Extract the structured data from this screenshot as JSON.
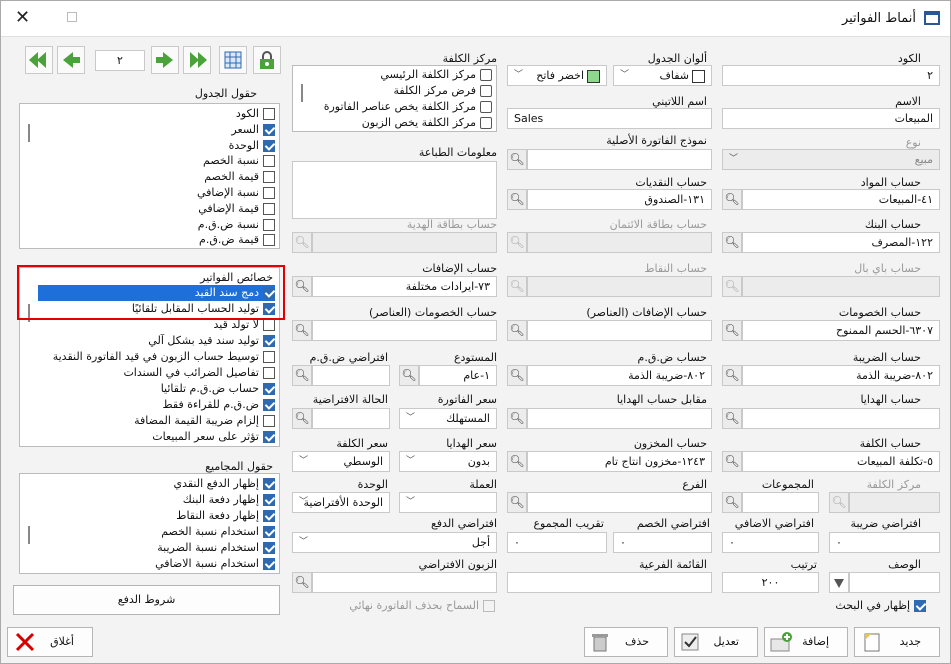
{
  "window": {
    "title": "أنماط الفواتير"
  },
  "toolbar": {
    "page_value": "٢"
  },
  "fields": {
    "code_label": "الكود",
    "code_value": "٢",
    "table_colors_label": "ألوان الجدول",
    "color1": "شفاف",
    "color2": "اخضر فاتح",
    "cost_center_label": "مركز الكلفة",
    "name_label": "الاسم",
    "name_value": "المبيعات",
    "latin_name_label": "اسم اللاتيني",
    "latin_name_value": "Sales",
    "type_label": "نوع",
    "type_value": "مبيع",
    "original_invoice_label": "نموذج الفاتورة الأصلية",
    "print_info_label": "معلومات الطباعة",
    "materials_account_label": "حساب المواد",
    "materials_account_value": "٤١-المبيعات",
    "cash_account_label": "حساب النقديات",
    "cash_account_value": "١٣١-الصندوق",
    "bank_account_label": "حساب البنك",
    "bank_account_value": "١٢٢-المصرف",
    "credit_account_label": "حساب بطاقة الائتمان",
    "gift_card_account_label": "حساب بطاقة الهدية",
    "paypal_account_label": "حساب باي بال",
    "points_account_label": "حساب النقاط",
    "additions_account_label": "حساب الإضافات",
    "additions_account_value": "٧٣-ايرادات مختلفة",
    "discounts_account_label": "حساب الخصومات",
    "discounts_account_value": "٦٣٠٧-الحسم الممنوح",
    "additions_items_label": "حساب الإضافات (العناصر)",
    "discounts_items_label": "حساب الخصومات (العناصر)",
    "tax_account_label": "حساب الضريبة",
    "tax_account_value": "٨٠٢-ضريبة الذمة",
    "vat_account_label": "حساب ض.ق.م",
    "vat_account_value": "٨٠٢-ضريبة الذمة",
    "warehouse_label": "المستودع",
    "warehouse_value": "١-عام",
    "default_vat_label": "افتراضي ض.ق.م",
    "gifts_account_label": "حساب الهدايا",
    "gifts_contra_label": "مقابل حساب الهدايا",
    "invoice_price_label": "سعر الفاتورة",
    "invoice_price_value": "المستهلك",
    "default_state_label": "الحالة الافتراضية",
    "cost_account_label": "حساب الكلفة",
    "cost_account_value": "٥-تكلفة المبيعات",
    "inventory_account_label": "حساب المخزون",
    "inventory_account_value": "١٢٤٣-مخزون انتاج تام",
    "gifts_price_label": "سعر الهدايا",
    "gifts_price_value": "بدون",
    "cost_price_label": "سعر الكلفة",
    "cost_price_value": "الوسطي",
    "cost_center2_label": "مركز الكلفة",
    "groups_label": "المجموعات",
    "branch_label": "الفرع",
    "currency_label": "العملة",
    "unit_label": "الوحدة",
    "unit_value": "الوحدة الأفتراضية",
    "default_tax_label": "افتراضي ضريبة",
    "default_tax_value": "٠",
    "default_addition_label": "افتراضي الاضافي",
    "default_addition_value": "٠",
    "default_discount_label": "افتراضي الخصم",
    "default_discount_value": "٠",
    "total_rounding_label": "تقريب المجموع",
    "total_rounding_value": "٠",
    "default_payment_label": "افتراضي الدفع",
    "default_payment_value": "أجل",
    "description_label": "الوصف",
    "order_label": "ترتيب",
    "order_value": "٢٠٠",
    "sub_list_label": "القائمة الفرعية",
    "default_customer_label": "الزبون الافتراضي",
    "show_in_search_label": "إظهار في البحث",
    "allow_final_delete_label": "السماح بحذف الفاتورة نهائي"
  },
  "cost_center_options": [
    {
      "label": "مركز الكلفة الرئيسي",
      "checked": false
    },
    {
      "label": "فرض مركز الكلفة",
      "checked": false
    },
    {
      "label": "مركز الكلفة يخص عناصر الفاتورة",
      "checked": false
    },
    {
      "label": "مركز الكلفة يخص الزبون",
      "checked": false
    }
  ],
  "table_fields": {
    "title": "حقول الجدول",
    "items": [
      {
        "label": "الكود",
        "checked": false
      },
      {
        "label": "السعر",
        "checked": true
      },
      {
        "label": "الوحدة",
        "checked": true
      },
      {
        "label": "نسبة الخصم",
        "checked": false
      },
      {
        "label": "قيمة الخصم",
        "checked": false
      },
      {
        "label": "نسبة الإضافي",
        "checked": false
      },
      {
        "label": "قيمة الإضافي",
        "checked": false
      },
      {
        "label": "نسبة ض.ق.م",
        "checked": false
      },
      {
        "label": "قيمة ض.ق.م",
        "checked": false
      }
    ]
  },
  "invoice_props": {
    "title": "خصائص الفواتير",
    "items": [
      {
        "label": "دمج سند القيد",
        "checked": true,
        "selected": true
      },
      {
        "label": "توليد الحساب المقابل تلقائيًا",
        "checked": true
      },
      {
        "label": "لا تولد قيد",
        "checked": false
      },
      {
        "label": "توليد سند قيد بشكل آلي",
        "checked": true
      },
      {
        "label": "توسيط حساب الزبون في قيد الفاتورة النقدية",
        "checked": false
      },
      {
        "label": "تفاصيل الضرائب في السندات",
        "checked": false
      },
      {
        "label": "حساب ض.ق.م تلقائيا",
        "checked": true
      },
      {
        "label": "ض.ق.م للقراءة فقط",
        "checked": true
      },
      {
        "label": "إلزام ضريبة القيمة المضافة",
        "checked": false
      },
      {
        "label": "تؤثر على سعر المبيعات",
        "checked": true
      }
    ]
  },
  "totals_fields": {
    "title": "حقول المجاميع",
    "items": [
      {
        "label": "إظهار الدفع النقدي",
        "checked": true
      },
      {
        "label": "إظهار دفعة البنك",
        "checked": true
      },
      {
        "label": "إظهار دفعة النقاط",
        "checked": true
      },
      {
        "label": "استخدام نسبة الخصم",
        "checked": true
      },
      {
        "label": "استخدام نسبة الضريبة",
        "checked": true
      },
      {
        "label": "استخدام نسبة الاضافي",
        "checked": true
      }
    ]
  },
  "buttons": {
    "payment_terms": "شروط الدفع",
    "close": "أغلاق",
    "new": "جديد",
    "add": "إضافة",
    "edit": "تعديل",
    "delete": "حذف"
  }
}
